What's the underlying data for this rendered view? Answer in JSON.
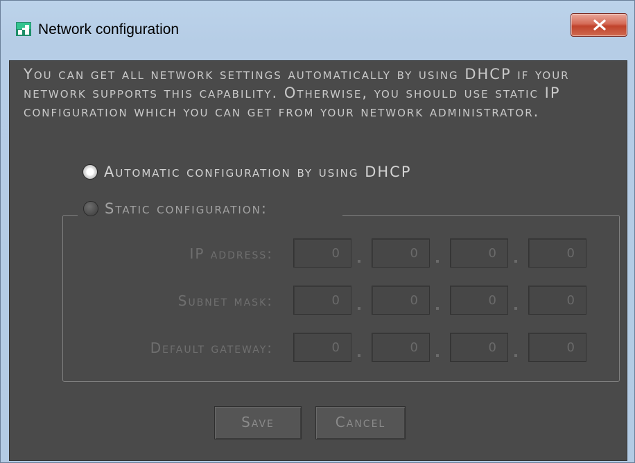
{
  "window": {
    "title": "Network configuration",
    "close_glyph": "X"
  },
  "intro": "You can get all network settings automatically by using DHCP if your network supports this capability. Otherwise, you should use static IP configuration which you can get from your network administrator.",
  "options": {
    "automatic": {
      "label": "Automatic configuration by using DHCP",
      "selected": true
    },
    "static": {
      "label": "Static configuration:",
      "selected": false
    }
  },
  "fields": [
    {
      "label": "IP address:",
      "octets": [
        "0",
        "0",
        "0",
        "0"
      ]
    },
    {
      "label": "Subnet mask:",
      "octets": [
        "0",
        "0",
        "0",
        "0"
      ]
    },
    {
      "label": "Default gateway:",
      "octets": [
        "0",
        "0",
        "0",
        "0"
      ]
    }
  ],
  "buttons": {
    "save": "Save",
    "cancel": "Cancel"
  },
  "colors": {
    "panel": "#4a4a4a",
    "titlebar": "#b8cfe7",
    "close": "#c7503a"
  }
}
